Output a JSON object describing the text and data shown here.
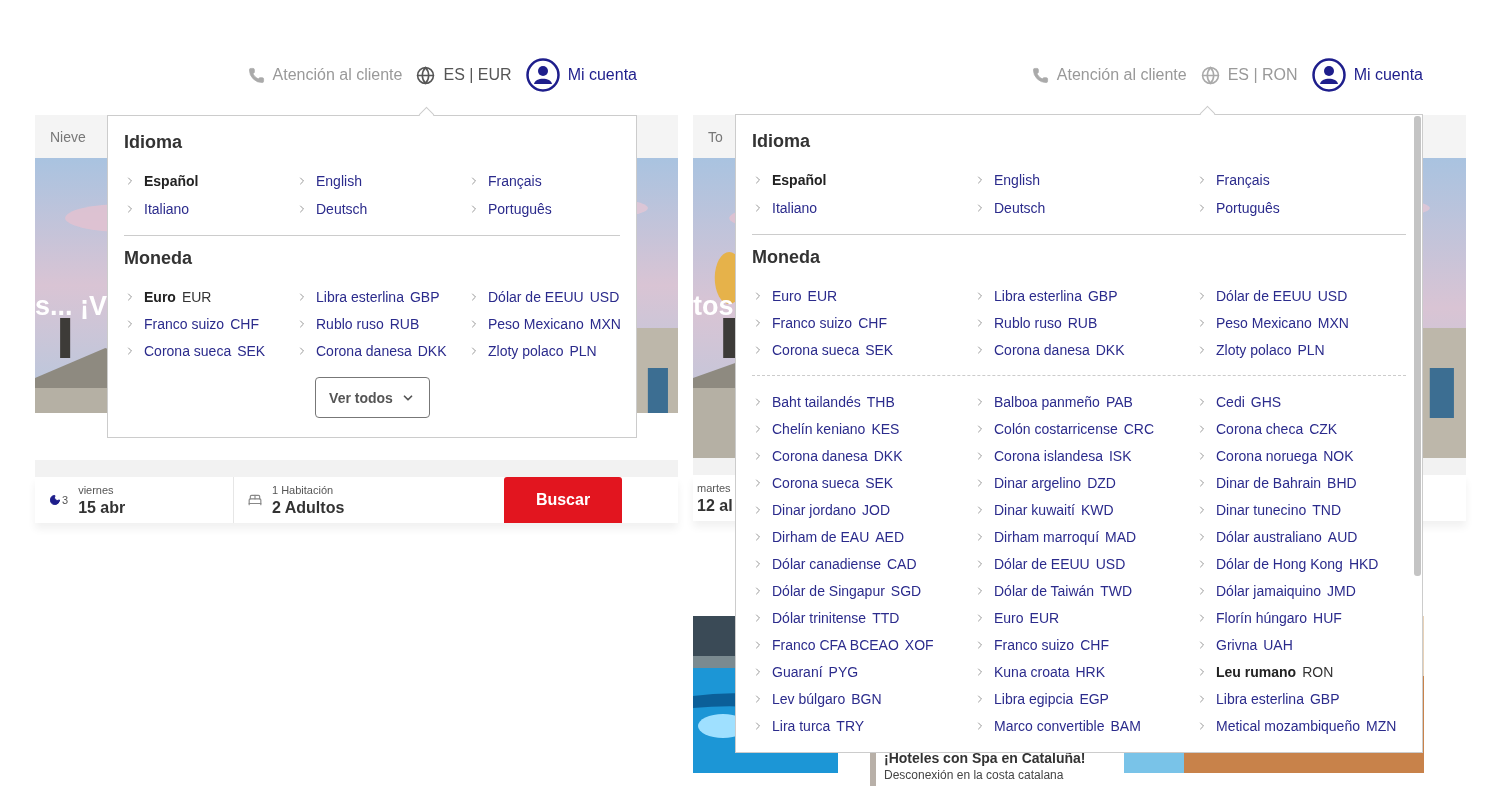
{
  "screens": [
    {
      "nav": {
        "support": "Atención al cliente",
        "locale": "ES | EUR",
        "account": "Mi cuenta"
      },
      "tab": "Nieve",
      "hero_text": "s... ¡V",
      "search": {
        "nights": "3",
        "date_label": "viernes",
        "date": "15 abr",
        "rooms": "1 Habitación",
        "guests": "2 Adultos",
        "button": "Buscar"
      },
      "dropdown": {
        "language_title": "Idioma",
        "languages": [
          {
            "label": "Español",
            "selected": true
          },
          {
            "label": "English",
            "selected": false
          },
          {
            "label": "Français",
            "selected": false
          },
          {
            "label": "Italiano",
            "selected": false
          },
          {
            "label": "Deutsch",
            "selected": false
          },
          {
            "label": "Português",
            "selected": false
          }
        ],
        "currency_title": "Moneda",
        "currencies": [
          {
            "name": "Euro",
            "code": "EUR",
            "selected": true
          },
          {
            "name": "Libra esterlina",
            "code": "GBP",
            "selected": false
          },
          {
            "name": "Dólar de EEUU",
            "code": "USD",
            "selected": false
          },
          {
            "name": "Franco suizo",
            "code": "CHF",
            "selected": false
          },
          {
            "name": "Rublo ruso",
            "code": "RUB",
            "selected": false
          },
          {
            "name": "Peso Mexicano",
            "code": "MXN",
            "selected": false
          },
          {
            "name": "Corona sueca",
            "code": "SEK",
            "selected": false
          },
          {
            "name": "Corona danesa",
            "code": "DKK",
            "selected": false
          },
          {
            "name": "Zloty polaco",
            "code": "PLN",
            "selected": false
          }
        ],
        "show_all_button": "Ver todos"
      }
    },
    {
      "nav": {
        "support": "Atención al cliente",
        "locale": "ES | RON",
        "account": "Mi cuenta"
      },
      "tab": "To",
      "hero_text": "tos",
      "search": {
        "date_label": "martes",
        "date": "12 al"
      },
      "promo": {
        "title": "¡Hoteles con Spa en Cataluña!",
        "subtitle": "Desconexión en la costa catalana"
      },
      "dropdown": {
        "language_title": "Idioma",
        "languages": [
          {
            "label": "Español",
            "selected": true
          },
          {
            "label": "English",
            "selected": false
          },
          {
            "label": "Français",
            "selected": false
          },
          {
            "label": "Italiano",
            "selected": false
          },
          {
            "label": "Deutsch",
            "selected": false
          },
          {
            "label": "Português",
            "selected": false
          }
        ],
        "currency_title": "Moneda",
        "currencies": [
          {
            "name": "Euro",
            "code": "EUR",
            "selected": false
          },
          {
            "name": "Libra esterlina",
            "code": "GBP",
            "selected": false
          },
          {
            "name": "Dólar de EEUU",
            "code": "USD",
            "selected": false
          },
          {
            "name": "Franco suizo",
            "code": "CHF",
            "selected": false
          },
          {
            "name": "Rublo ruso",
            "code": "RUB",
            "selected": false
          },
          {
            "name": "Peso Mexicano",
            "code": "MXN",
            "selected": false
          },
          {
            "name": "Corona sueca",
            "code": "SEK",
            "selected": false
          },
          {
            "name": "Corona danesa",
            "code": "DKK",
            "selected": false
          },
          {
            "name": "Zloty polaco",
            "code": "PLN",
            "selected": false
          }
        ],
        "all_currencies": [
          {
            "name": "Baht tailandés",
            "code": "THB",
            "selected": false
          },
          {
            "name": "Balboa panmeño",
            "code": "PAB",
            "selected": false
          },
          {
            "name": "Cedi",
            "code": "GHS",
            "selected": false
          },
          {
            "name": "Chelín keniano",
            "code": "KES",
            "selected": false
          },
          {
            "name": "Colón costarricense",
            "code": "CRC",
            "selected": false
          },
          {
            "name": "Corona checa",
            "code": "CZK",
            "selected": false
          },
          {
            "name": "Corona danesa",
            "code": "DKK",
            "selected": false
          },
          {
            "name": "Corona islandesa",
            "code": "ISK",
            "selected": false
          },
          {
            "name": "Corona noruega",
            "code": "NOK",
            "selected": false
          },
          {
            "name": "Corona sueca",
            "code": "SEK",
            "selected": false
          },
          {
            "name": "Dinar argelino",
            "code": "DZD",
            "selected": false
          },
          {
            "name": "Dinar de Bahrain",
            "code": "BHD",
            "selected": false
          },
          {
            "name": "Dinar jordano",
            "code": "JOD",
            "selected": false
          },
          {
            "name": "Dinar kuwaití",
            "code": "KWD",
            "selected": false
          },
          {
            "name": "Dinar tunecino",
            "code": "TND",
            "selected": false
          },
          {
            "name": "Dirham de EAU",
            "code": "AED",
            "selected": false
          },
          {
            "name": "Dirham marroquí",
            "code": "MAD",
            "selected": false
          },
          {
            "name": "Dólar australiano",
            "code": "AUD",
            "selected": false
          },
          {
            "name": "Dólar canadiense",
            "code": "CAD",
            "selected": false
          },
          {
            "name": "Dólar de EEUU",
            "code": "USD",
            "selected": false
          },
          {
            "name": "Dólar de Hong Kong",
            "code": "HKD",
            "selected": false
          },
          {
            "name": "Dólar de Singapur",
            "code": "SGD",
            "selected": false
          },
          {
            "name": "Dólar de Taiwán",
            "code": "TWD",
            "selected": false
          },
          {
            "name": "Dólar jamaiquino",
            "code": "JMD",
            "selected": false
          },
          {
            "name": "Dólar trinitense",
            "code": "TTD",
            "selected": false
          },
          {
            "name": "Euro",
            "code": "EUR",
            "selected": false
          },
          {
            "name": "Florín húngaro",
            "code": "HUF",
            "selected": false
          },
          {
            "name": "Franco CFA BCEAO",
            "code": "XOF",
            "selected": false
          },
          {
            "name": "Franco suizo",
            "code": "CHF",
            "selected": false
          },
          {
            "name": "Grivna",
            "code": "UAH",
            "selected": false
          },
          {
            "name": "Guaraní",
            "code": "PYG",
            "selected": false
          },
          {
            "name": "Kuna croata",
            "code": "HRK",
            "selected": false
          },
          {
            "name": "Leu rumano",
            "code": "RON",
            "selected": true
          },
          {
            "name": "Lev búlgaro",
            "code": "BGN",
            "selected": false
          },
          {
            "name": "Libra egipcia",
            "code": "EGP",
            "selected": false
          },
          {
            "name": "Libra esterlina",
            "code": "GBP",
            "selected": false
          },
          {
            "name": "Lira turca",
            "code": "TRY",
            "selected": false
          },
          {
            "name": "Marco convertible",
            "code": "BAM",
            "selected": false
          },
          {
            "name": "Metical mozambiqueño",
            "code": "MZN",
            "selected": false
          }
        ]
      }
    }
  ]
}
